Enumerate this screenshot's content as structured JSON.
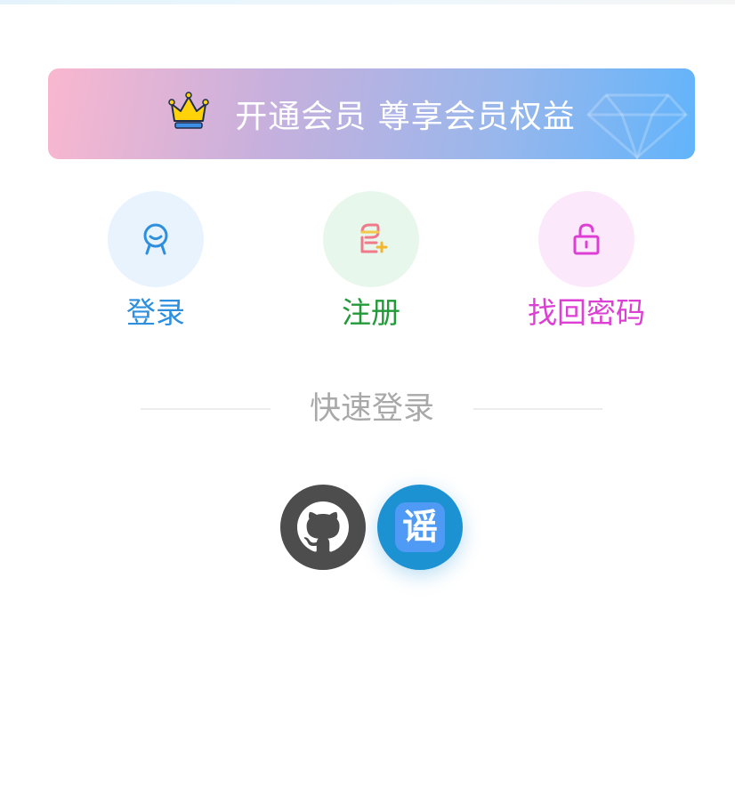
{
  "vip_banner": {
    "text": "开通会员 尊享会员权益",
    "icon": "crown-icon"
  },
  "actions": [
    {
      "label": "登录",
      "icon": "user-icon",
      "color": "#2d8fdd",
      "bg": "#e8f3fd"
    },
    {
      "label": "注册",
      "icon": "add-user-icon",
      "color": "#229a3a",
      "bg": "#e8f7ec"
    },
    {
      "label": "找回密码",
      "icon": "unlock-icon",
      "color": "#dd3fd4",
      "bg": "#fbe8fb"
    }
  ],
  "quick_login": {
    "label": "快速登录",
    "providers": [
      {
        "icon": "github-icon",
        "color": "#4d4d4d"
      },
      {
        "icon": "yao-icon",
        "glyph": "谣",
        "color": "#1d92d3"
      }
    ]
  }
}
